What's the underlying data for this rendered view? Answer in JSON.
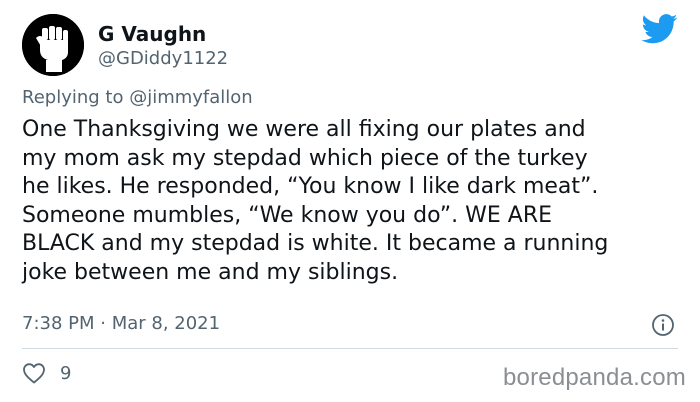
{
  "author": {
    "display_name": "G Vaughn",
    "handle": "@GDiddy1122",
    "avatar_icon": "raised-fist-icon"
  },
  "reply": {
    "prefix": "Replying to ",
    "mention": "@jimmyfallon"
  },
  "body_lines": [
    "One Thanksgiving we were all fixing our plates and",
    "my mom ask my stepdad which piece of the turkey",
    "he likes. He responded, “You know I like dark meat”.",
    "Someone mumbles, “We know you do”. WE ARE",
    "BLACK and my stepdad is white. It became a running",
    "joke between me and my siblings."
  ],
  "timestamp": "7:38 PM · Mar 8, 2021",
  "likes": "9",
  "watermark": "boredpanda.com",
  "colors": {
    "twitter_blue": "#1d9bf0",
    "muted": "#536471",
    "text": "#0f1419"
  }
}
